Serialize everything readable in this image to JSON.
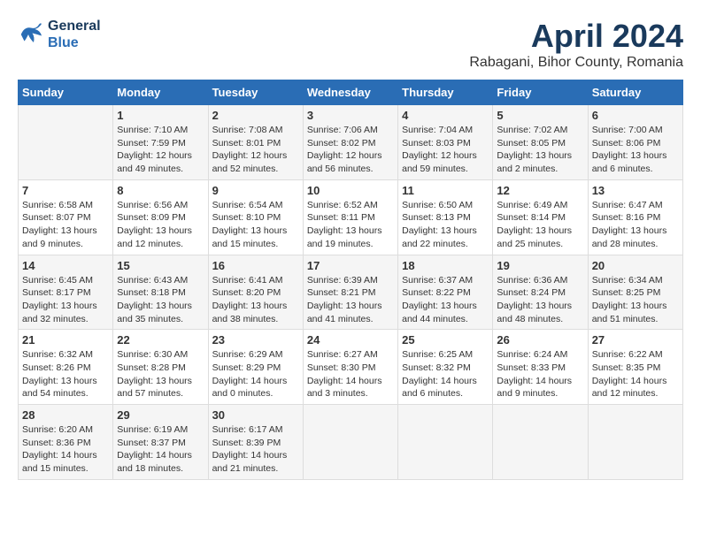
{
  "header": {
    "logo_line1": "General",
    "logo_line2": "Blue",
    "title": "April 2024",
    "subtitle": "Rabagani, Bihor County, Romania"
  },
  "weekdays": [
    "Sunday",
    "Monday",
    "Tuesday",
    "Wednesday",
    "Thursday",
    "Friday",
    "Saturday"
  ],
  "weeks": [
    [
      {
        "day": "",
        "sunrise": "",
        "sunset": "",
        "daylight": ""
      },
      {
        "day": "1",
        "sunrise": "Sunrise: 7:10 AM",
        "sunset": "Sunset: 7:59 PM",
        "daylight": "Daylight: 12 hours and 49 minutes."
      },
      {
        "day": "2",
        "sunrise": "Sunrise: 7:08 AM",
        "sunset": "Sunset: 8:01 PM",
        "daylight": "Daylight: 12 hours and 52 minutes."
      },
      {
        "day": "3",
        "sunrise": "Sunrise: 7:06 AM",
        "sunset": "Sunset: 8:02 PM",
        "daylight": "Daylight: 12 hours and 56 minutes."
      },
      {
        "day": "4",
        "sunrise": "Sunrise: 7:04 AM",
        "sunset": "Sunset: 8:03 PM",
        "daylight": "Daylight: 12 hours and 59 minutes."
      },
      {
        "day": "5",
        "sunrise": "Sunrise: 7:02 AM",
        "sunset": "Sunset: 8:05 PM",
        "daylight": "Daylight: 13 hours and 2 minutes."
      },
      {
        "day": "6",
        "sunrise": "Sunrise: 7:00 AM",
        "sunset": "Sunset: 8:06 PM",
        "daylight": "Daylight: 13 hours and 6 minutes."
      }
    ],
    [
      {
        "day": "7",
        "sunrise": "Sunrise: 6:58 AM",
        "sunset": "Sunset: 8:07 PM",
        "daylight": "Daylight: 13 hours and 9 minutes."
      },
      {
        "day": "8",
        "sunrise": "Sunrise: 6:56 AM",
        "sunset": "Sunset: 8:09 PM",
        "daylight": "Daylight: 13 hours and 12 minutes."
      },
      {
        "day": "9",
        "sunrise": "Sunrise: 6:54 AM",
        "sunset": "Sunset: 8:10 PM",
        "daylight": "Daylight: 13 hours and 15 minutes."
      },
      {
        "day": "10",
        "sunrise": "Sunrise: 6:52 AM",
        "sunset": "Sunset: 8:11 PM",
        "daylight": "Daylight: 13 hours and 19 minutes."
      },
      {
        "day": "11",
        "sunrise": "Sunrise: 6:50 AM",
        "sunset": "Sunset: 8:13 PM",
        "daylight": "Daylight: 13 hours and 22 minutes."
      },
      {
        "day": "12",
        "sunrise": "Sunrise: 6:49 AM",
        "sunset": "Sunset: 8:14 PM",
        "daylight": "Daylight: 13 hours and 25 minutes."
      },
      {
        "day": "13",
        "sunrise": "Sunrise: 6:47 AM",
        "sunset": "Sunset: 8:16 PM",
        "daylight": "Daylight: 13 hours and 28 minutes."
      }
    ],
    [
      {
        "day": "14",
        "sunrise": "Sunrise: 6:45 AM",
        "sunset": "Sunset: 8:17 PM",
        "daylight": "Daylight: 13 hours and 32 minutes."
      },
      {
        "day": "15",
        "sunrise": "Sunrise: 6:43 AM",
        "sunset": "Sunset: 8:18 PM",
        "daylight": "Daylight: 13 hours and 35 minutes."
      },
      {
        "day": "16",
        "sunrise": "Sunrise: 6:41 AM",
        "sunset": "Sunset: 8:20 PM",
        "daylight": "Daylight: 13 hours and 38 minutes."
      },
      {
        "day": "17",
        "sunrise": "Sunrise: 6:39 AM",
        "sunset": "Sunset: 8:21 PM",
        "daylight": "Daylight: 13 hours and 41 minutes."
      },
      {
        "day": "18",
        "sunrise": "Sunrise: 6:37 AM",
        "sunset": "Sunset: 8:22 PM",
        "daylight": "Daylight: 13 hours and 44 minutes."
      },
      {
        "day": "19",
        "sunrise": "Sunrise: 6:36 AM",
        "sunset": "Sunset: 8:24 PM",
        "daylight": "Daylight: 13 hours and 48 minutes."
      },
      {
        "day": "20",
        "sunrise": "Sunrise: 6:34 AM",
        "sunset": "Sunset: 8:25 PM",
        "daylight": "Daylight: 13 hours and 51 minutes."
      }
    ],
    [
      {
        "day": "21",
        "sunrise": "Sunrise: 6:32 AM",
        "sunset": "Sunset: 8:26 PM",
        "daylight": "Daylight: 13 hours and 54 minutes."
      },
      {
        "day": "22",
        "sunrise": "Sunrise: 6:30 AM",
        "sunset": "Sunset: 8:28 PM",
        "daylight": "Daylight: 13 hours and 57 minutes."
      },
      {
        "day": "23",
        "sunrise": "Sunrise: 6:29 AM",
        "sunset": "Sunset: 8:29 PM",
        "daylight": "Daylight: 14 hours and 0 minutes."
      },
      {
        "day": "24",
        "sunrise": "Sunrise: 6:27 AM",
        "sunset": "Sunset: 8:30 PM",
        "daylight": "Daylight: 14 hours and 3 minutes."
      },
      {
        "day": "25",
        "sunrise": "Sunrise: 6:25 AM",
        "sunset": "Sunset: 8:32 PM",
        "daylight": "Daylight: 14 hours and 6 minutes."
      },
      {
        "day": "26",
        "sunrise": "Sunrise: 6:24 AM",
        "sunset": "Sunset: 8:33 PM",
        "daylight": "Daylight: 14 hours and 9 minutes."
      },
      {
        "day": "27",
        "sunrise": "Sunrise: 6:22 AM",
        "sunset": "Sunset: 8:35 PM",
        "daylight": "Daylight: 14 hours and 12 minutes."
      }
    ],
    [
      {
        "day": "28",
        "sunrise": "Sunrise: 6:20 AM",
        "sunset": "Sunset: 8:36 PM",
        "daylight": "Daylight: 14 hours and 15 minutes."
      },
      {
        "day": "29",
        "sunrise": "Sunrise: 6:19 AM",
        "sunset": "Sunset: 8:37 PM",
        "daylight": "Daylight: 14 hours and 18 minutes."
      },
      {
        "day": "30",
        "sunrise": "Sunrise: 6:17 AM",
        "sunset": "Sunset: 8:39 PM",
        "daylight": "Daylight: 14 hours and 21 minutes."
      },
      {
        "day": "",
        "sunrise": "",
        "sunset": "",
        "daylight": ""
      },
      {
        "day": "",
        "sunrise": "",
        "sunset": "",
        "daylight": ""
      },
      {
        "day": "",
        "sunrise": "",
        "sunset": "",
        "daylight": ""
      },
      {
        "day": "",
        "sunrise": "",
        "sunset": "",
        "daylight": ""
      }
    ]
  ]
}
